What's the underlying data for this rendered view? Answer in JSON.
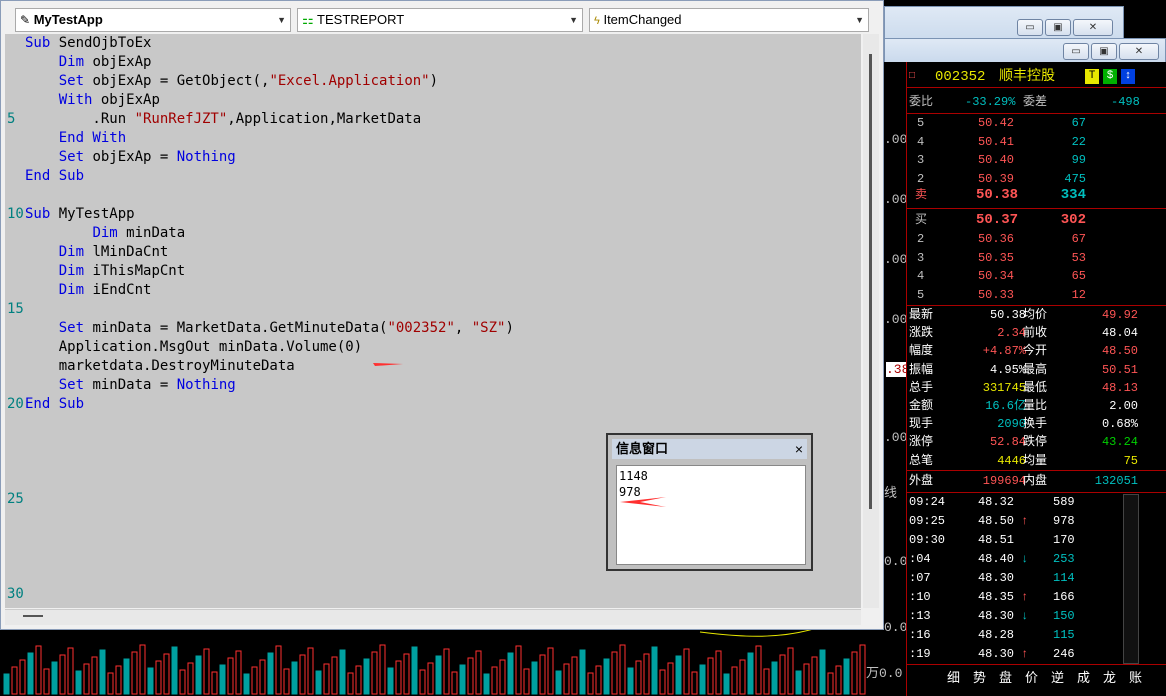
{
  "editor": {
    "module": "MyTestApp",
    "object": "TESTREPORT",
    "event": "ItemChanged",
    "code_lines": [
      {
        "n": "",
        "t": [
          [
            "kw",
            "Sub"
          ],
          [
            "",
            "SendOjbToEx"
          ]
        ]
      },
      {
        "n": "",
        "t": [
          [
            "",
            "    "
          ],
          [
            "kw",
            "Dim"
          ],
          [
            "",
            "objExAp"
          ]
        ]
      },
      {
        "n": "",
        "t": [
          [
            "",
            "    "
          ],
          [
            "kw",
            "Set"
          ],
          [
            "",
            "objExAp = GetObject(,"
          ],
          [
            "str",
            "\"Excel.Application\""
          ],
          [
            "",
            ")"
          ]
        ]
      },
      {
        "n": "",
        "t": [
          [
            "",
            "    "
          ],
          [
            "kw",
            "With"
          ],
          [
            "",
            "objExAp"
          ]
        ]
      },
      {
        "n": "5",
        "t": [
          [
            "",
            "        .Run "
          ],
          [
            "str",
            "\"RunRefJZT\""
          ],
          [
            "",
            ",Application,MarketData"
          ]
        ]
      },
      {
        "n": "",
        "t": [
          [
            "",
            "    "
          ],
          [
            "kw",
            "End With"
          ]
        ]
      },
      {
        "n": "",
        "t": [
          [
            "",
            "    "
          ],
          [
            "kw",
            "Set"
          ],
          [
            "",
            "objExAp = "
          ],
          [
            "kw",
            "Nothing"
          ]
        ]
      },
      {
        "n": "",
        "t": [
          [
            "kw",
            "End Sub"
          ]
        ]
      },
      {
        "n": "",
        "t": []
      },
      {
        "n": "10",
        "t": [
          [
            "kw",
            "Sub"
          ],
          [
            "",
            "MyTestApp"
          ]
        ]
      },
      {
        "n": "",
        "t": [
          [
            "",
            "        "
          ],
          [
            "kw",
            "Dim"
          ],
          [
            "",
            "minData"
          ]
        ]
      },
      {
        "n": "",
        "t": [
          [
            "",
            "    "
          ],
          [
            "kw",
            "Dim"
          ],
          [
            "",
            "lMinDaCnt"
          ]
        ]
      },
      {
        "n": "",
        "t": [
          [
            "",
            "    "
          ],
          [
            "kw",
            "Dim"
          ],
          [
            "",
            "iThisMapCnt"
          ]
        ]
      },
      {
        "n": "",
        "t": [
          [
            "",
            "    "
          ],
          [
            "kw",
            "Dim"
          ],
          [
            "",
            "iEndCnt"
          ]
        ]
      },
      {
        "n": "15",
        "t": []
      },
      {
        "n": "",
        "t": [
          [
            "",
            "    "
          ],
          [
            "kw",
            "Set"
          ],
          [
            "",
            "minData = MarketData.GetMinuteData("
          ],
          [
            "str",
            "\"002352\""
          ],
          [
            "",
            ", "
          ],
          [
            "str",
            "\"SZ\""
          ],
          [
            "",
            ")"
          ]
        ]
      },
      {
        "n": "",
        "t": [
          [
            "",
            "    Application.MsgOut minData.Volume(0)"
          ]
        ]
      },
      {
        "n": "",
        "t": [
          [
            "",
            "    marketdata.DestroyMinuteData"
          ]
        ]
      },
      {
        "n": "",
        "t": [
          [
            "",
            "    "
          ],
          [
            "kw",
            "Set"
          ],
          [
            "",
            "minData = "
          ],
          [
            "kw",
            "Nothing"
          ]
        ]
      },
      {
        "n": "20",
        "t": [
          [
            "kw",
            "End Sub"
          ]
        ]
      },
      {
        "n": "",
        "t": []
      },
      {
        "n": "",
        "t": []
      },
      {
        "n": "",
        "t": []
      },
      {
        "n": "",
        "t": []
      },
      {
        "n": "25",
        "t": []
      },
      {
        "n": "",
        "t": []
      },
      {
        "n": "",
        "t": []
      },
      {
        "n": "",
        "t": []
      },
      {
        "n": "",
        "t": []
      },
      {
        "n": "30",
        "t": []
      }
    ]
  },
  "info_window": {
    "title": "信息窗口",
    "close": "×",
    "lines": [
      "1148",
      "978"
    ]
  },
  "chart": {
    "ylabels": [
      ".00",
      ".00",
      ".00",
      ".00",
      ".38",
      ".00",
      "0.0",
      "0.0",
      "万0.0"
    ],
    "xlabel": "线"
  },
  "stock": {
    "code": "002352",
    "name": "顺丰控股",
    "badges": [
      "T",
      "$",
      "↕"
    ],
    "weibi_label": "委比",
    "weibi": "-33.29%",
    "weicha_label": "委差",
    "weicha": "-498",
    "sells": [
      [
        "5",
        "50.42",
        "67"
      ],
      [
        "4",
        "50.41",
        "22"
      ],
      [
        "3",
        "50.40",
        "99"
      ],
      [
        "2",
        "50.39",
        "475"
      ]
    ],
    "sell1": [
      "卖",
      "50.38",
      "334"
    ],
    "buy1": [
      "买",
      "50.37",
      "302"
    ],
    "buys": [
      [
        "2",
        "50.36",
        "67"
      ],
      [
        "3",
        "50.35",
        "53"
      ],
      [
        "4",
        "50.34",
        "65"
      ],
      [
        "5",
        "50.33",
        "12"
      ]
    ],
    "stats": [
      [
        "最新",
        "50.38",
        "均价",
        "49.92"
      ],
      [
        "涨跌",
        "2.34",
        "前收",
        "48.04"
      ],
      [
        "幅度",
        "+4.87%",
        "今开",
        "48.50"
      ],
      [
        "振幅",
        "4.95%",
        "最高",
        "50.51"
      ],
      [
        "总手",
        "331745",
        "最低",
        "48.13"
      ],
      [
        "金额",
        "16.6亿",
        "量比",
        "2.00"
      ],
      [
        "现手",
        "2090",
        "换手",
        "0.68%"
      ],
      [
        "涨停",
        "52.84",
        "跌停",
        "43.24"
      ],
      [
        "总笔",
        "4446",
        "均量",
        "75"
      ]
    ],
    "waipan_label": "外盘",
    "waipan": "199694",
    "neipan_label": "内盘",
    "neipan": "132051",
    "ticks": [
      [
        "09:24",
        "48.32",
        "",
        "589"
      ],
      [
        "09:25",
        "48.50",
        "↑",
        "978"
      ],
      [
        "09:30",
        "48.51",
        "",
        "170"
      ],
      [
        ":04",
        "48.40",
        "↓",
        "253"
      ],
      [
        ":07",
        "48.30",
        "",
        "114"
      ],
      [
        ":10",
        "48.35",
        "↑",
        "166"
      ],
      [
        ":13",
        "48.30",
        "↓",
        "150"
      ],
      [
        ":16",
        "48.28",
        "",
        "115"
      ],
      [
        ":19",
        "48.30",
        "↑",
        "246"
      ]
    ],
    "bottom_tabs": [
      "细",
      "势",
      "盘",
      "价",
      "逆",
      "成",
      "龙",
      "账"
    ]
  }
}
